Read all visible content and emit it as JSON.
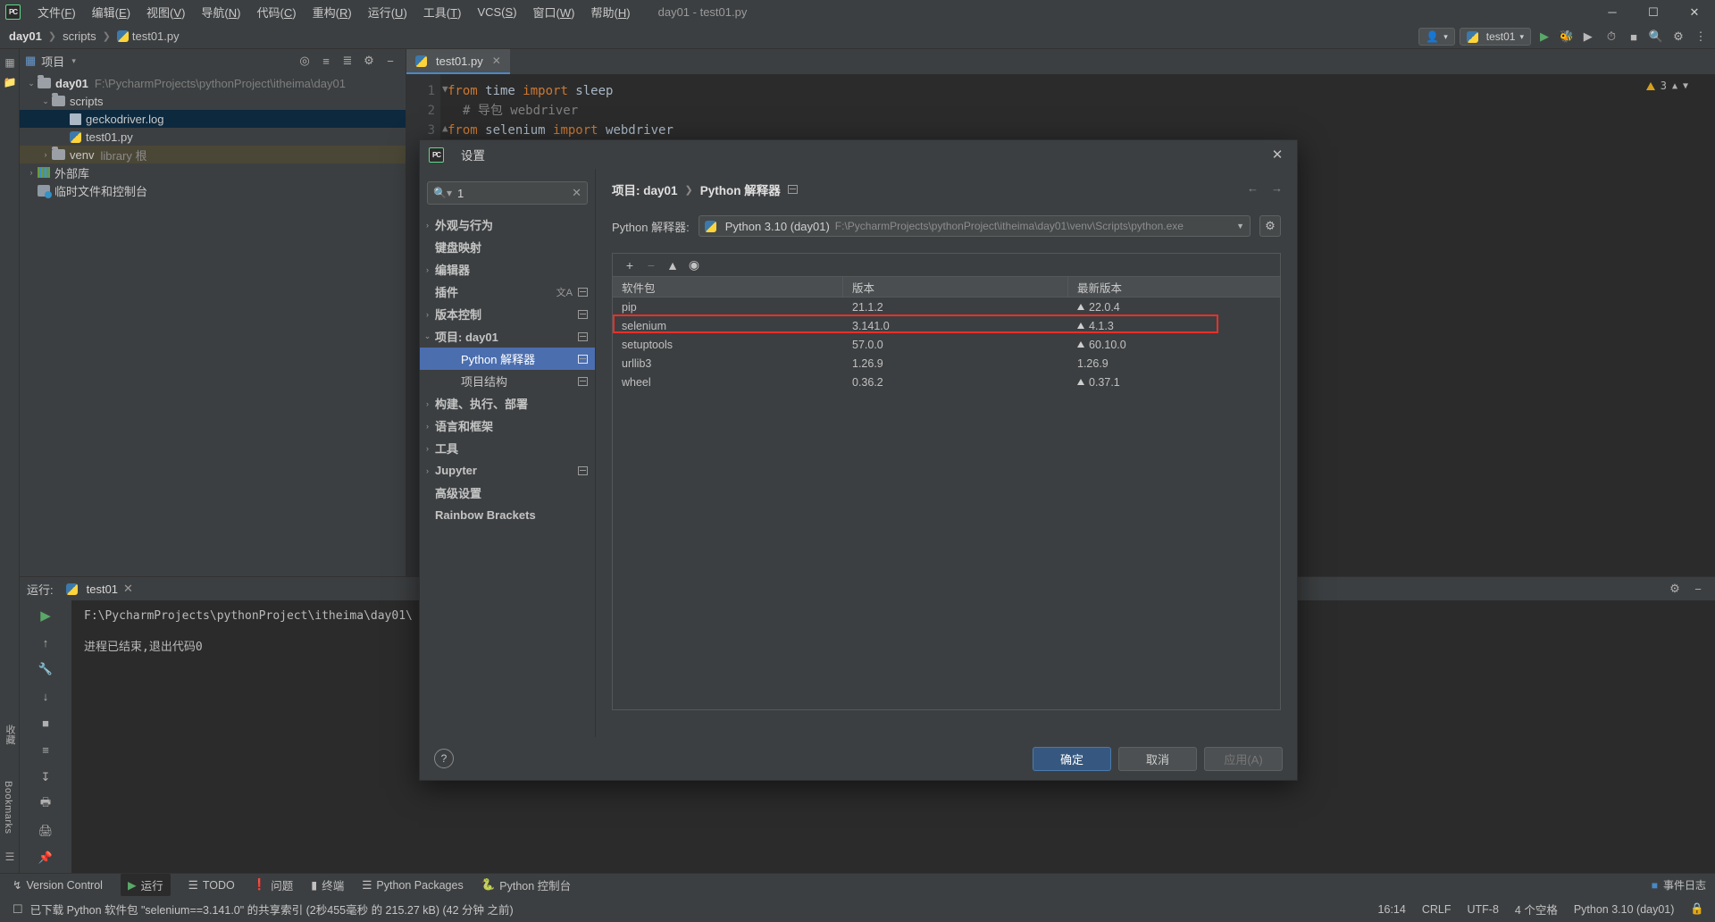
{
  "window": {
    "title": "day01 - test01.py",
    "logo": "pycharm-logo",
    "controls": {
      "minimize": "─",
      "maximize": "☐",
      "close": "✕"
    }
  },
  "menubar": [
    {
      "label": "文件",
      "mnemonic": "F"
    },
    {
      "label": "编辑",
      "mnemonic": "E"
    },
    {
      "label": "视图",
      "mnemonic": "V"
    },
    {
      "label": "导航",
      "mnemonic": "N"
    },
    {
      "label": "代码",
      "mnemonic": "C"
    },
    {
      "label": "重构",
      "mnemonic": "R"
    },
    {
      "label": "运行",
      "mnemonic": "U"
    },
    {
      "label": "工具",
      "mnemonic": "T"
    },
    {
      "label": "VCS",
      "mnemonic": "S"
    },
    {
      "label": "窗口",
      "mnemonic": "W"
    },
    {
      "label": "帮助",
      "mnemonic": "H"
    }
  ],
  "navbar": {
    "breadcrumb": [
      "day01",
      "scripts",
      "test01.py"
    ],
    "run_config": "test01",
    "icons": [
      "profiler-icon",
      "run-icon",
      "debug-icon",
      "coverage-icon",
      "profile-icon",
      "stop-icon",
      "search-everywhere-icon",
      "settings-icon",
      "more-icon"
    ]
  },
  "project_panel": {
    "title": "项目",
    "header_icons": [
      "locate-icon",
      "expand-all-icon",
      "collapse-all-icon",
      "settings-icon",
      "hide-icon"
    ],
    "tree": [
      {
        "label": "day01",
        "detail": "F:\\PycharmProjects\\pythonProject\\itheima\\day01",
        "indent": 0,
        "arrow": "⌄",
        "icon": "folder-icon",
        "bold": true,
        "state": "normal"
      },
      {
        "label": "scripts",
        "detail": "",
        "indent": 1,
        "arrow": "⌄",
        "icon": "folder-icon",
        "bold": false,
        "state": "normal"
      },
      {
        "label": "geckodriver.log",
        "detail": "",
        "indent": 2,
        "arrow": "",
        "icon": "log-file-icon",
        "bold": false,
        "state": "selected"
      },
      {
        "label": "test01.py",
        "detail": "",
        "indent": 2,
        "arrow": "",
        "icon": "python-file-icon",
        "bold": false,
        "state": "normal"
      },
      {
        "label": "venv",
        "detail": "library 根",
        "indent": 1,
        "arrow": "›",
        "icon": "folder-icon",
        "bold": false,
        "state": "venv"
      },
      {
        "label": "外部库",
        "detail": "",
        "indent": 0,
        "arrow": "›",
        "icon": "library-icon",
        "bold": false,
        "state": "normal"
      },
      {
        "label": "临时文件和控制台",
        "detail": "",
        "indent": 0,
        "arrow": "",
        "icon": "scratches-icon",
        "bold": false,
        "state": "normal"
      }
    ]
  },
  "left_strip": {
    "items": [
      "项目",
      "结构",
      "书签",
      "收藏"
    ]
  },
  "editor": {
    "tab": {
      "label": "test01.py",
      "icon": "python-file-icon",
      "close": "✕"
    },
    "warnings": {
      "count": "3",
      "icon": "warning-icon"
    },
    "lines": [
      {
        "no": "1",
        "segments": [
          {
            "t": "from",
            "c": "kw"
          },
          {
            "t": " time ",
            "c": "id"
          },
          {
            "t": "import",
            "c": "kw"
          },
          {
            "t": " sleep",
            "c": "id"
          }
        ]
      },
      {
        "no": "2",
        "segments": [
          {
            "t": "# 导包 webdriver",
            "c": "cm"
          }
        ]
      },
      {
        "no": "3",
        "segments": [
          {
            "t": "from",
            "c": "kw"
          },
          {
            "t": " selenium ",
            "c": "id"
          },
          {
            "t": "import",
            "c": "kw"
          },
          {
            "t": " webdriver",
            "c": "id"
          }
        ]
      }
    ]
  },
  "run_window": {
    "label": "运行:",
    "tab": "test01",
    "tab_close": "✕",
    "gutter_icons": [
      "rerun-icon",
      "up-icon",
      "down-icon",
      "stop-icon",
      "soft-wrap-icon",
      "scroll-end-icon",
      "print-icon",
      "pin-icon",
      "trash-icon"
    ],
    "console": [
      "F:\\PycharmProjects\\pythonProject\\itheima\\day01\\",
      "进程已结束,退出代码0"
    ]
  },
  "status_top": {
    "items": [
      {
        "label": "Version Control",
        "icon": "vcs-icon",
        "active": false
      },
      {
        "label": "运行",
        "icon": "run-icon",
        "active": true
      },
      {
        "label": "TODO",
        "icon": "todo-icon",
        "active": false
      },
      {
        "label": "问题",
        "icon": "problems-icon",
        "active": false
      },
      {
        "label": "终端",
        "icon": "terminal-icon",
        "active": false
      },
      {
        "label": "Python Packages",
        "icon": "packages-icon",
        "active": false
      },
      {
        "label": "Python 控制台",
        "icon": "python-console-icon",
        "active": false
      }
    ],
    "right": {
      "label": "事件日志",
      "icon": "event-log-icon"
    }
  },
  "status_bottom": {
    "message": "已下载 Python 软件包 \"selenium==3.141.0\" 的共享索引 (2秒455毫秒 的 215.27 kB) (42 分钟 之前)",
    "icon": "info-icon",
    "right": [
      "16:14",
      "CRLF",
      "UTF-8",
      "4 个空格",
      "Python 3.10 (day01)",
      "lock-icon"
    ]
  },
  "dialog": {
    "title": "设置",
    "icon": "pycharm-logo",
    "close": "✕",
    "search": {
      "value": "1",
      "icon": "search-icon",
      "clear": "✕"
    },
    "sidebar": [
      {
        "label": "外观与行为",
        "arrow": "›",
        "indent": 0,
        "bold": true,
        "badges": [],
        "selected": false
      },
      {
        "label": "键盘映射",
        "arrow": "",
        "indent": 1,
        "bold": true,
        "badges": [],
        "selected": false
      },
      {
        "label": "编辑器",
        "arrow": "›",
        "indent": 0,
        "bold": true,
        "badges": [],
        "selected": false
      },
      {
        "label": "插件",
        "arrow": "",
        "indent": 1,
        "bold": true,
        "badges": [
          "translate-icon",
          "copy-icon"
        ],
        "selected": false
      },
      {
        "label": "版本控制",
        "arrow": "›",
        "indent": 0,
        "bold": true,
        "badges": [
          "copy-icon"
        ],
        "selected": false
      },
      {
        "label": "项目: day01",
        "arrow": "⌄",
        "indent": 0,
        "bold": true,
        "badges": [
          "copy-icon"
        ],
        "selected": false
      },
      {
        "label": "Python 解释器",
        "arrow": "",
        "indent": 2,
        "bold": false,
        "badges": [
          "copy-icon"
        ],
        "selected": true
      },
      {
        "label": "项目结构",
        "arrow": "",
        "indent": 2,
        "bold": false,
        "badges": [
          "copy-icon"
        ],
        "selected": false
      },
      {
        "label": "构建、执行、部署",
        "arrow": "›",
        "indent": 0,
        "bold": true,
        "badges": [],
        "selected": false
      },
      {
        "label": "语言和框架",
        "arrow": "›",
        "indent": 0,
        "bold": true,
        "badges": [],
        "selected": false
      },
      {
        "label": "工具",
        "arrow": "›",
        "indent": 0,
        "bold": true,
        "badges": [],
        "selected": false
      },
      {
        "label": "Jupyter",
        "arrow": "›",
        "indent": 0,
        "bold": true,
        "badges": [
          "copy-icon"
        ],
        "selected": false
      },
      {
        "label": "高级设置",
        "arrow": "",
        "indent": 1,
        "bold": true,
        "badges": [],
        "selected": false
      },
      {
        "label": "Rainbow Brackets",
        "arrow": "",
        "indent": 1,
        "bold": true,
        "badges": [],
        "selected": false
      }
    ],
    "main": {
      "breadcrumb": [
        "项目: day01",
        "Python 解释器"
      ],
      "breadcrumb_icon": "copy-icon",
      "nav_back": "←",
      "nav_forward": "→",
      "interpreter_label": "Python 解释器:",
      "interpreter_value": "Python 3.10 (day01)",
      "interpreter_path": "F:\\PycharmProjects\\pythonProject\\itheima\\day01\\venv\\Scripts\\python.exe",
      "interpreter_icon": "python-icon",
      "gear_icon": "gear-icon",
      "toolbar_icons": [
        "add-package-icon",
        "remove-package-icon",
        "upgrade-package-icon",
        "show-early-releases-icon"
      ],
      "table": {
        "columns": [
          "软件包",
          "版本",
          "最新版本"
        ],
        "rows": [
          {
            "package": "pip",
            "version": "21.1.2",
            "latest": "22.0.4",
            "upgradable": true,
            "highlighted": false
          },
          {
            "package": "selenium",
            "version": "3.141.0",
            "latest": "4.1.3",
            "upgradable": true,
            "highlighted": true
          },
          {
            "package": "setuptools",
            "version": "57.0.0",
            "latest": "60.10.0",
            "upgradable": true,
            "highlighted": false
          },
          {
            "package": "urllib3",
            "version": "1.26.9",
            "latest": "1.26.9",
            "upgradable": false,
            "highlighted": false
          },
          {
            "package": "wheel",
            "version": "0.36.2",
            "latest": "0.37.1",
            "upgradable": true,
            "highlighted": false
          }
        ]
      }
    },
    "footer": {
      "help": "?",
      "ok": "确定",
      "cancel": "取消",
      "apply": "应用(A)"
    }
  },
  "colors": {
    "accent": "#4b6eaf",
    "highlight": "#e8302a",
    "panel": "#3c3f41",
    "editor": "#2b2b2b",
    "selection": "#0d293e"
  }
}
